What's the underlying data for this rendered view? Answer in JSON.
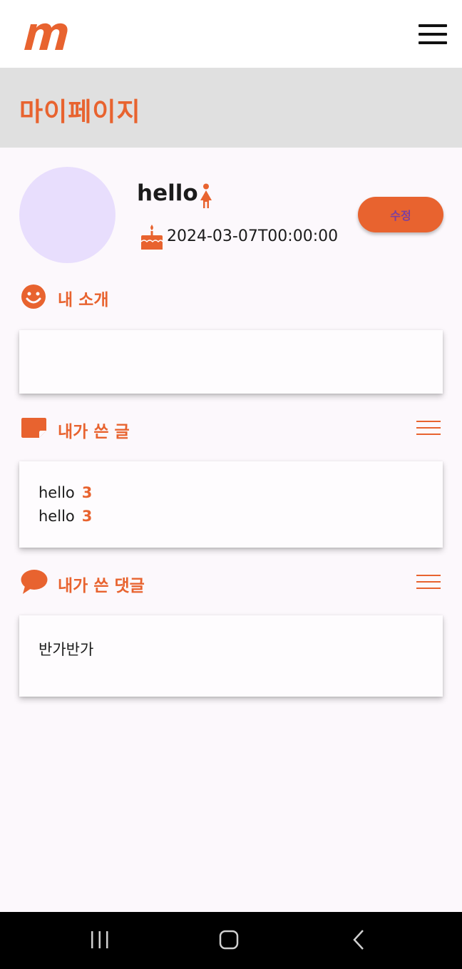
{
  "app": {
    "logo_letter": "m",
    "brand_color": "#e8632f"
  },
  "header": {
    "menu_icon": "hamburger-menu-icon"
  },
  "page": {
    "title": "마이페이지"
  },
  "profile": {
    "username": "hello",
    "gender_icon": "female-icon",
    "birthday_icon": "cake-icon",
    "birthdate": "2024-03-07T00:00:00",
    "edit_label": "수정"
  },
  "intro": {
    "icon": "smiley-icon",
    "title": "내 소개",
    "body": ""
  },
  "posts": {
    "icon": "note-icon",
    "title": "내가 쓴 글",
    "list_icon": "list-icon",
    "items": [
      {
        "title": "hello",
        "count": "3"
      },
      {
        "title": "hello",
        "count": "3"
      }
    ]
  },
  "comments": {
    "icon": "speech-bubble-icon",
    "title": "내가 쓴 댓글",
    "list_icon": "list-icon",
    "items": [
      "반가반가"
    ]
  },
  "system_nav": {
    "recents": "recents-icon",
    "home": "home-icon",
    "back": "back-icon"
  }
}
